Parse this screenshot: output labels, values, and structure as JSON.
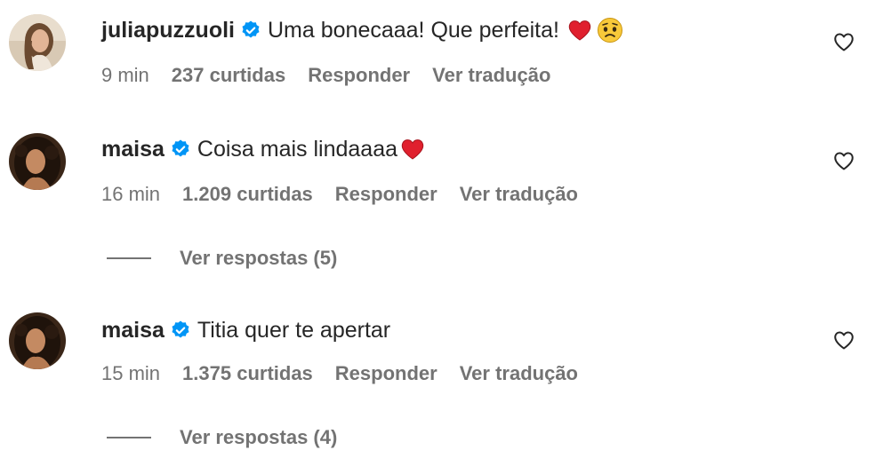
{
  "comments": [
    {
      "username": "juliapuzzuoli",
      "text": "Uma bonecaaa! Que perfeita!",
      "emojis": [
        "red-heart-emoji",
        "pleading-face-emoji"
      ],
      "time": "9 min",
      "likes": "237 curtidas",
      "reply_label": "Responder",
      "translate_label": "Ver tradução"
    },
    {
      "username": "maisa",
      "text": "Coisa mais lindaaaa",
      "emojis": [
        "red-heart-emoji"
      ],
      "time": "16 min",
      "likes": "1.209 curtidas",
      "reply_label": "Responder",
      "translate_label": "Ver tradução",
      "view_replies": "Ver respostas (5)"
    },
    {
      "username": "maisa",
      "text": "Titia quer te apertar",
      "emojis": [],
      "time": "15 min",
      "likes": "1.375 curtidas",
      "reply_label": "Responder",
      "translate_label": "Ver tradução",
      "view_replies": "Ver respostas (4)"
    }
  ],
  "colors": {
    "verified_badge": "#0095f6",
    "secondary_text": "#737373",
    "primary_text": "#262626"
  }
}
